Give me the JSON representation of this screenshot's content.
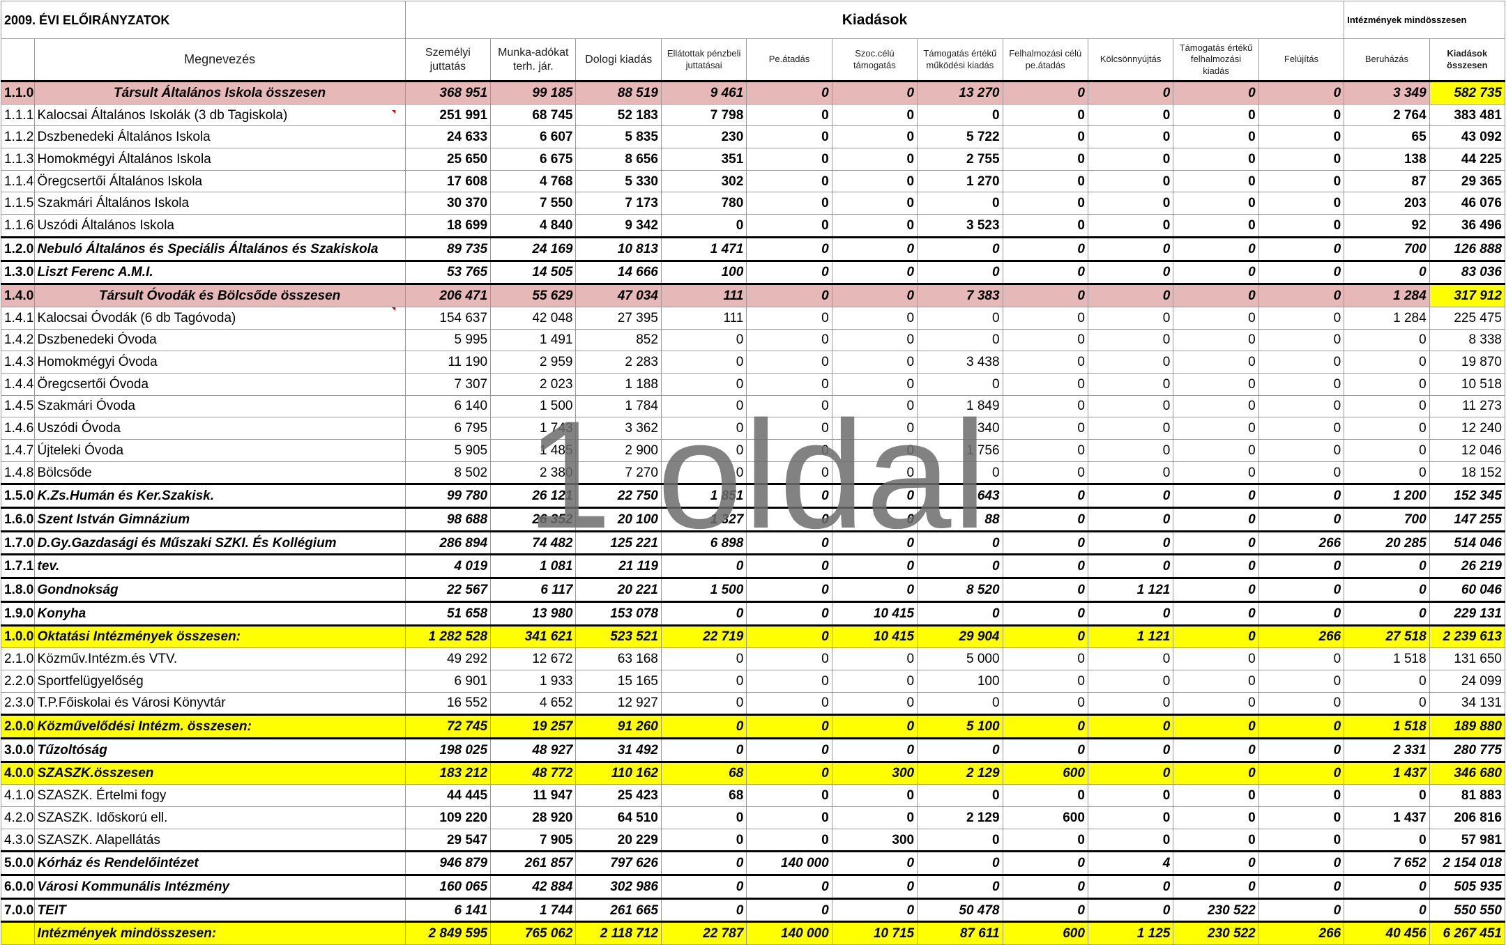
{
  "header": {
    "title": "2009. ÉVI ELŐIRÁNYZATOK",
    "group": "Kiadások",
    "right": "Intézmények mindösszesen"
  },
  "columns": [
    "Megnevezés",
    "Személyi juttatás",
    "Munka-adókat terh. jár.",
    "Dologi kiadás",
    "Ellátottak pénzbeli juttatásai",
    "Pe.átadás",
    "Szoc.célú támogatás",
    "Támogatás értékű működési kiadás",
    "Felhalmozási célú pe.átadás",
    "Kölcsönnyújtás",
    "Támogatás értékű felhalmozási kiadás",
    "Felújítás",
    "Beruházás",
    "Kiadások összesen"
  ],
  "rows": [
    {
      "code": "1.1.0",
      "name": "Társult Általános Iskola összesen",
      "style": "pink",
      "values": [
        "368 951",
        "99 185",
        "88 519",
        "9 461",
        "0",
        "0",
        "13 270",
        "0",
        "0",
        "0",
        "0",
        "3 349",
        "582 735"
      ]
    },
    {
      "code": "1.1.1",
      "name": "Kalocsai Általános Iskolák (3 db Tagiskola)",
      "style": "mid",
      "values": [
        "251 991",
        "68 745",
        "52 183",
        "7 798",
        "0",
        "0",
        "0",
        "0",
        "0",
        "0",
        "0",
        "2 764",
        "383 481"
      ]
    },
    {
      "code": "1.1.2",
      "name": "Dszbenedeki Általános Iskola",
      "style": "mid",
      "values": [
        "24 633",
        "6 607",
        "5 835",
        "230",
        "0",
        "0",
        "5 722",
        "0",
        "0",
        "0",
        "0",
        "65",
        "43 092"
      ]
    },
    {
      "code": "1.1.3",
      "name": "Homokmégyi Általános Iskola",
      "style": "mid",
      "values": [
        "25 650",
        "6 675",
        "8 656",
        "351",
        "0",
        "0",
        "2 755",
        "0",
        "0",
        "0",
        "0",
        "138",
        "44 225"
      ]
    },
    {
      "code": "1.1.4",
      "name": "Öregcsertői Általános Iskola",
      "style": "mid",
      "values": [
        "17 608",
        "4 768",
        "5 330",
        "302",
        "0",
        "0",
        "1 270",
        "0",
        "0",
        "0",
        "0",
        "87",
        "29 365"
      ]
    },
    {
      "code": "1.1.5",
      "name": "Szakmári Általános Iskola",
      "style": "mid",
      "values": [
        "30 370",
        "7 550",
        "7 173",
        "780",
        "0",
        "0",
        "0",
        "0",
        "0",
        "0",
        "0",
        "203",
        "46 076"
      ]
    },
    {
      "code": "1.1.6",
      "name": "Uszódi Általános Iskola",
      "style": "mid",
      "values": [
        "18 699",
        "4 840",
        "9 342",
        "0",
        "0",
        "0",
        "3 523",
        "0",
        "0",
        "0",
        "0",
        "92",
        "36 496"
      ]
    },
    {
      "code": "1.2.0",
      "name": "Nebuló Általános és Speciális Általános és Szakiskola",
      "style": "bold",
      "values": [
        "89 735",
        "24 169",
        "10 813",
        "1 471",
        "0",
        "0",
        "0",
        "0",
        "0",
        "0",
        "0",
        "700",
        "126 888"
      ]
    },
    {
      "code": "1.3.0",
      "name": "Liszt Ferenc A.M.I.",
      "style": "bold",
      "values": [
        "53 765",
        "14 505",
        "14 666",
        "100",
        "0",
        "0",
        "0",
        "0",
        "0",
        "0",
        "0",
        "0",
        "83 036"
      ]
    },
    {
      "code": "1.4.0",
      "name": "Társult Óvodák és Bölcsőde összesen",
      "style": "pink",
      "values": [
        "206 471",
        "55 629",
        "47 034",
        "111",
        "0",
        "0",
        "7 383",
        "0",
        "0",
        "0",
        "0",
        "1 284",
        "317 912"
      ]
    },
    {
      "code": "1.4.1",
      "name": "Kalocsai Óvodák (6 db Tagóvoda)",
      "style": "plain",
      "values": [
        "154 637",
        "42 048",
        "27 395",
        "111",
        "0",
        "0",
        "0",
        "0",
        "0",
        "0",
        "0",
        "1 284",
        "225 475"
      ]
    },
    {
      "code": "1.4.2",
      "name": "Dszbenedeki Óvoda",
      "style": "plain",
      "values": [
        "5 995",
        "1 491",
        "852",
        "0",
        "0",
        "0",
        "0",
        "0",
        "0",
        "0",
        "0",
        "0",
        "8 338"
      ]
    },
    {
      "code": "1.4.3",
      "name": "Homokmégyi Óvoda",
      "style": "plain",
      "values": [
        "11 190",
        "2 959",
        "2 283",
        "0",
        "0",
        "0",
        "3 438",
        "0",
        "0",
        "0",
        "0",
        "0",
        "19 870"
      ]
    },
    {
      "code": "1.4.4",
      "name": "Öregcsertői Óvoda",
      "style": "plain",
      "values": [
        "7 307",
        "2 023",
        "1 188",
        "0",
        "0",
        "0",
        "0",
        "0",
        "0",
        "0",
        "0",
        "0",
        "10 518"
      ]
    },
    {
      "code": "1.4.5",
      "name": "Szakmári Óvoda",
      "style": "plain",
      "values": [
        "6 140",
        "1 500",
        "1 784",
        "0",
        "0",
        "0",
        "1 849",
        "0",
        "0",
        "0",
        "0",
        "0",
        "11 273"
      ]
    },
    {
      "code": "1.4.6",
      "name": "Uszódi Óvoda",
      "style": "plain",
      "values": [
        "6 795",
        "1 743",
        "3 362",
        "0",
        "0",
        "0",
        "340",
        "0",
        "0",
        "0",
        "0",
        "0",
        "12 240"
      ]
    },
    {
      "code": "1.4.7",
      "name": "Újteleki Óvoda",
      "style": "plain",
      "values": [
        "5 905",
        "1 485",
        "2 900",
        "0",
        "0",
        "0",
        "1 756",
        "0",
        "0",
        "0",
        "0",
        "0",
        "12 046"
      ]
    },
    {
      "code": "1.4.8",
      "name": "Bölcsőde",
      "style": "plain",
      "values": [
        "8 502",
        "2 380",
        "7 270",
        "0",
        "0",
        "0",
        "0",
        "0",
        "0",
        "0",
        "0",
        "0",
        "18 152"
      ]
    },
    {
      "code": "1.5.0",
      "name": "K.Zs.Humán és Ker.Szakisk.",
      "style": "bold",
      "values": [
        "99 780",
        "26 121",
        "22 750",
        "1 851",
        "0",
        "0",
        "643",
        "0",
        "0",
        "0",
        "0",
        "1 200",
        "152 345"
      ]
    },
    {
      "code": "1.6.0",
      "name": "Szent István Gimnázium",
      "style": "bold",
      "values": [
        "98 688",
        "26 352",
        "20 100",
        "1 327",
        "0",
        "0",
        "88",
        "0",
        "0",
        "0",
        "0",
        "700",
        "147 255"
      ]
    },
    {
      "code": "1.7.0",
      "name": "D.Gy.Gazdasági és Műszaki SZKI. És Kollégium",
      "style": "bold",
      "values": [
        "286 894",
        "74 482",
        "125 221",
        "6 898",
        "0",
        "0",
        "0",
        "0",
        "0",
        "0",
        "266",
        "20 285",
        "514 046"
      ]
    },
    {
      "code": "1.7.1",
      "name": "tev.",
      "style": "bold",
      "values": [
        "4 019",
        "1 081",
        "21 119",
        "0",
        "0",
        "0",
        "0",
        "0",
        "0",
        "0",
        "0",
        "0",
        "26 219"
      ]
    },
    {
      "code": "1.8.0",
      "name": "Gondnokság",
      "style": "bold",
      "values": [
        "22 567",
        "6 117",
        "20 221",
        "1 500",
        "0",
        "0",
        "8 520",
        "0",
        "1 121",
        "0",
        "0",
        "0",
        "60 046"
      ]
    },
    {
      "code": "1.9.0",
      "name": "Konyha",
      "style": "bold",
      "values": [
        "51 658",
        "13 980",
        "153 078",
        "0",
        "0",
        "10 415",
        "0",
        "0",
        "0",
        "0",
        "0",
        "0",
        "229 131"
      ]
    },
    {
      "code": "1.0.0",
      "name": "Oktatási Intézmények összesen:",
      "style": "yellow",
      "values": [
        "1 282 528",
        "341 621",
        "523 521",
        "22 719",
        "0",
        "10 415",
        "29 904",
        "0",
        "1 121",
        "0",
        "266",
        "27 518",
        "2 239 613"
      ]
    },
    {
      "code": "2.1.0",
      "name": "Közműv.Intézm.és VTV.",
      "style": "plain",
      "values": [
        "49 292",
        "12 672",
        "63 168",
        "0",
        "0",
        "0",
        "5 000",
        "0",
        "0",
        "0",
        "0",
        "1 518",
        "131 650"
      ]
    },
    {
      "code": "2.2.0",
      "name": "Sportfelügyelőség",
      "style": "plain",
      "values": [
        "6 901",
        "1 933",
        "15 165",
        "0",
        "0",
        "0",
        "100",
        "0",
        "0",
        "0",
        "0",
        "0",
        "24 099"
      ]
    },
    {
      "code": "2.3.0",
      "name": "T.P.Főiskolai és Városi Könyvtár",
      "style": "plain",
      "values": [
        "16 552",
        "4 652",
        "12 927",
        "0",
        "0",
        "0",
        "0",
        "0",
        "0",
        "0",
        "0",
        "0",
        "34 131"
      ]
    },
    {
      "code": "2.0.0",
      "name": "Közművelődési Intézm. összesen:",
      "style": "yellow",
      "values": [
        "72 745",
        "19 257",
        "91 260",
        "0",
        "0",
        "0",
        "5 100",
        "0",
        "0",
        "0",
        "0",
        "1 518",
        "189 880"
      ]
    },
    {
      "code": "3.0.0",
      "name": "Tűzoltóság",
      "style": "bold",
      "values": [
        "198 025",
        "48 927",
        "31 492",
        "0",
        "0",
        "0",
        "0",
        "0",
        "0",
        "0",
        "0",
        "2 331",
        "280 775"
      ]
    },
    {
      "code": "4.0.0",
      "name": "SZASZK.összesen",
      "style": "yellow",
      "values": [
        "183 212",
        "48 772",
        "110 162",
        "68",
        "0",
        "300",
        "2 129",
        "600",
        "0",
        "0",
        "0",
        "1 437",
        "346 680"
      ]
    },
    {
      "code": "4.1.0",
      "name": "SZASZK. Értelmi fogy",
      "style": "mid",
      "values": [
        "44 445",
        "11 947",
        "25 423",
        "68",
        "0",
        "0",
        "0",
        "0",
        "0",
        "0",
        "0",
        "0",
        "81 883"
      ]
    },
    {
      "code": "4.2.0",
      "name": "SZASZK. Időskorú ell.",
      "style": "mid",
      "values": [
        "109 220",
        "28 920",
        "64 510",
        "0",
        "0",
        "0",
        "2 129",
        "600",
        "0",
        "0",
        "0",
        "1 437",
        "206 816"
      ]
    },
    {
      "code": "4.3.0",
      "name": "SZASZK. Alapellátás",
      "style": "mid",
      "values": [
        "29 547",
        "7 905",
        "20 229",
        "0",
        "0",
        "300",
        "0",
        "0",
        "0",
        "0",
        "0",
        "0",
        "57 981"
      ]
    },
    {
      "code": "5.0.0",
      "name": "Kórház és Rendelőintézet",
      "style": "bold",
      "values": [
        "946 879",
        "261 857",
        "797 626",
        "0",
        "140 000",
        "0",
        "0",
        "0",
        "4",
        "0",
        "0",
        "7 652",
        "2 154 018"
      ]
    },
    {
      "code": "6.0.0",
      "name": "Városi Kommunális Intézmény",
      "style": "bold",
      "values": [
        "160 065",
        "42 884",
        "302 986",
        "0",
        "0",
        "0",
        "0",
        "0",
        "0",
        "0",
        "0",
        "0",
        "505 935"
      ]
    },
    {
      "code": "7.0.0",
      "name": "TEIT",
      "style": "bold",
      "values": [
        "6 141",
        "1 744",
        "261 665",
        "0",
        "0",
        "0",
        "50 478",
        "0",
        "0",
        "230 522",
        "0",
        "0",
        "550 550"
      ]
    },
    {
      "code": "",
      "name": "Intézmények mindösszesen:",
      "style": "yellow",
      "values": [
        "2 849 595",
        "765 062",
        "2 118 712",
        "22 787",
        "140 000",
        "10 715",
        "87 611",
        "600",
        "1 125",
        "230 522",
        "266",
        "40 456",
        "6 267 451"
      ]
    }
  ],
  "watermark": "1 oldal"
}
